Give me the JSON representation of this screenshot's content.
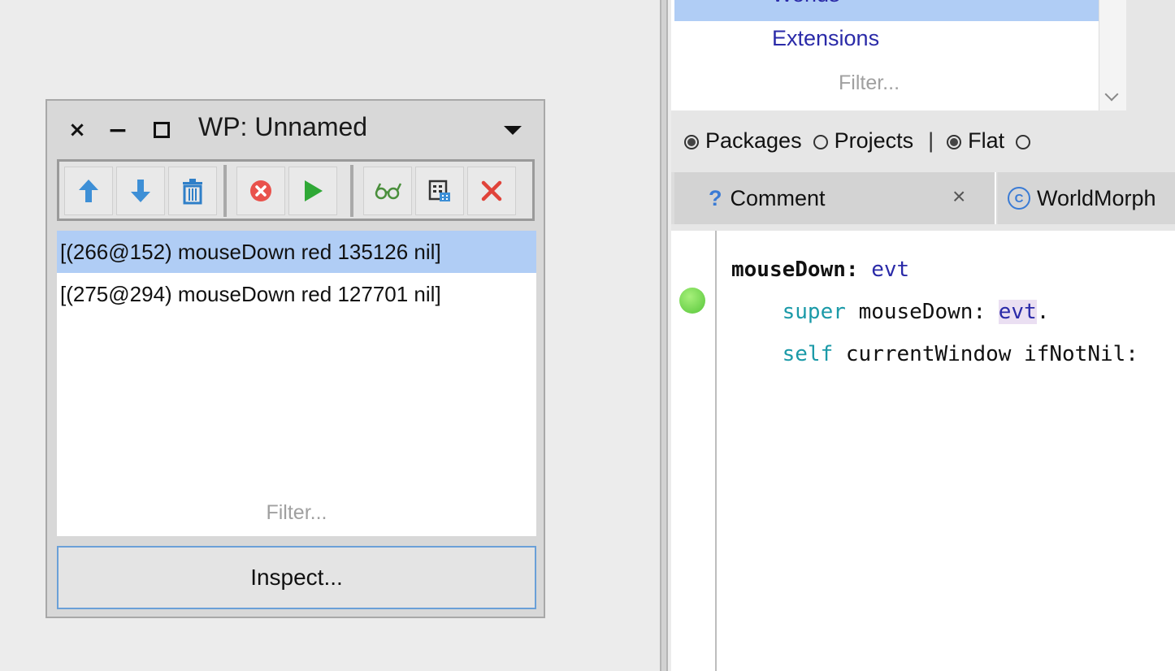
{
  "recorder_window": {
    "title": "WP: Unnamed",
    "close_glyph": "×",
    "minimize_glyph": "−",
    "toolbar": {
      "icons": [
        "arrow-up-icon",
        "arrow-down-icon",
        "trash-icon",
        "stop-icon",
        "play-icon",
        "glasses-icon",
        "grid-icon",
        "delete-icon"
      ]
    },
    "events": [
      "[(266@152) mouseDown red 135126 nil]",
      "[(275@294) mouseDown red 127701 nil]"
    ],
    "filter_placeholder": "Filter...",
    "inspect_label": "Inspect..."
  },
  "browser": {
    "packages": {
      "selected_item": "Worlds",
      "items": [
        "Extensions"
      ],
      "filter_placeholder": "Filter..."
    },
    "view_options": {
      "packages_label": "Packages",
      "projects_label": "Projects",
      "separator": "|",
      "flat_label": "Flat"
    },
    "tabs": {
      "comment_label": "Comment",
      "comment_icon_glyph": "?",
      "close_glyph": "×",
      "class_icon_glyph": "C",
      "class_label": "WorldMorph"
    },
    "code": {
      "line1_selector": "mouseDown:",
      "line1_arg": "evt",
      "line2_keyword": "super",
      "line2_message": "mouseDown:",
      "line2_arg": "evt",
      "line2_end": ".",
      "line3_keyword": "self",
      "line3_rest": "currentWindow ifNotNil:"
    }
  }
}
